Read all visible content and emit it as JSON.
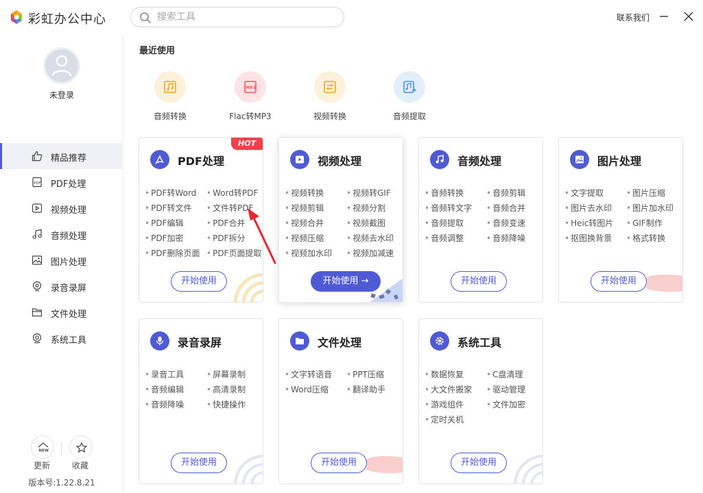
{
  "app": {
    "title": "彩虹办公中心"
  },
  "search": {
    "placeholder": "搜索工具"
  },
  "header": {
    "contact": "联系我们"
  },
  "user": {
    "login_label": "未登录"
  },
  "sidebar": {
    "items": [
      {
        "label": "精品推荐",
        "icon": "thumbs-up-icon"
      },
      {
        "label": "PDF处理",
        "icon": "pdf-icon"
      },
      {
        "label": "视频处理",
        "icon": "video-play-icon"
      },
      {
        "label": "音频处理",
        "icon": "music-note-icon"
      },
      {
        "label": "图片处理",
        "icon": "image-icon"
      },
      {
        "label": "录音录屏",
        "icon": "record-icon"
      },
      {
        "label": "文件处理",
        "icon": "folder-icon"
      },
      {
        "label": "系统工具",
        "icon": "system-icon"
      }
    ],
    "update_label": "更新",
    "update_badge": "NEW",
    "favorite_label": "收藏",
    "version": "版本号:1.22.8.21"
  },
  "recent": {
    "title": "最近使用",
    "items": [
      {
        "label": "音频转换",
        "icon": "audio-convert-icon",
        "color": "#f5a623"
      },
      {
        "label": "Flac转MP3",
        "icon": "flac-mp3-icon",
        "color": "#f2555a"
      },
      {
        "label": "视频转换",
        "icon": "video-convert-icon",
        "color": "#f5a623"
      },
      {
        "label": "音频提取",
        "icon": "audio-extract-icon",
        "color": "#4a90e2"
      }
    ]
  },
  "cards": [
    {
      "title": "PDF处理",
      "hot": "HOT",
      "features": [
        "PDF转Word",
        "Word转PDF",
        "PDF转文件",
        "文件转PDF",
        "PDF编辑",
        "PDF合并",
        "PDF加密",
        "PDF拆分",
        "PDF删除页面",
        "PDF页面提取"
      ],
      "button": "开始使用"
    },
    {
      "title": "视频处理",
      "features": [
        "视频转换",
        "视频转GIF",
        "视频剪辑",
        "视频分割",
        "视频合并",
        "视频截图",
        "视频压缩",
        "视频去水印",
        "视频加水印",
        "视频加减速"
      ],
      "button": "开始使用 →"
    },
    {
      "title": "音频处理",
      "features": [
        "音频转换",
        "音频剪辑",
        "音频转文字",
        "音频合并",
        "音频提取",
        "音频变速",
        "音频调整",
        "音频降噪"
      ],
      "button": "开始使用"
    },
    {
      "title": "图片处理",
      "features": [
        "文字提取",
        "图片压缩",
        "图片去水印",
        "图片加水印",
        "Heic转图片",
        "GIF制作",
        "抠图换背景",
        "格式转换"
      ],
      "button": "开始使用"
    },
    {
      "title": "录音录屏",
      "features": [
        "录音工具",
        "屏幕录制",
        "音频编辑",
        "高清录制",
        "音频降噪",
        "快捷操作"
      ],
      "button": "开始使用"
    },
    {
      "title": "文件处理",
      "features": [
        "文字转语音",
        "PPT压缩",
        "Word压缩",
        "翻译助手"
      ],
      "button": "开始使用"
    },
    {
      "title": "系统工具",
      "features": [
        "数据恢复",
        "C盘清理",
        "大文件搬家",
        "驱动管理",
        "游戏组件",
        "文件加密",
        "定时关机"
      ],
      "button": "开始使用"
    }
  ],
  "colors": {
    "accent": "#4f5bd5",
    "hot": "#f2404d",
    "annotation_arrow": "#e8262d"
  }
}
